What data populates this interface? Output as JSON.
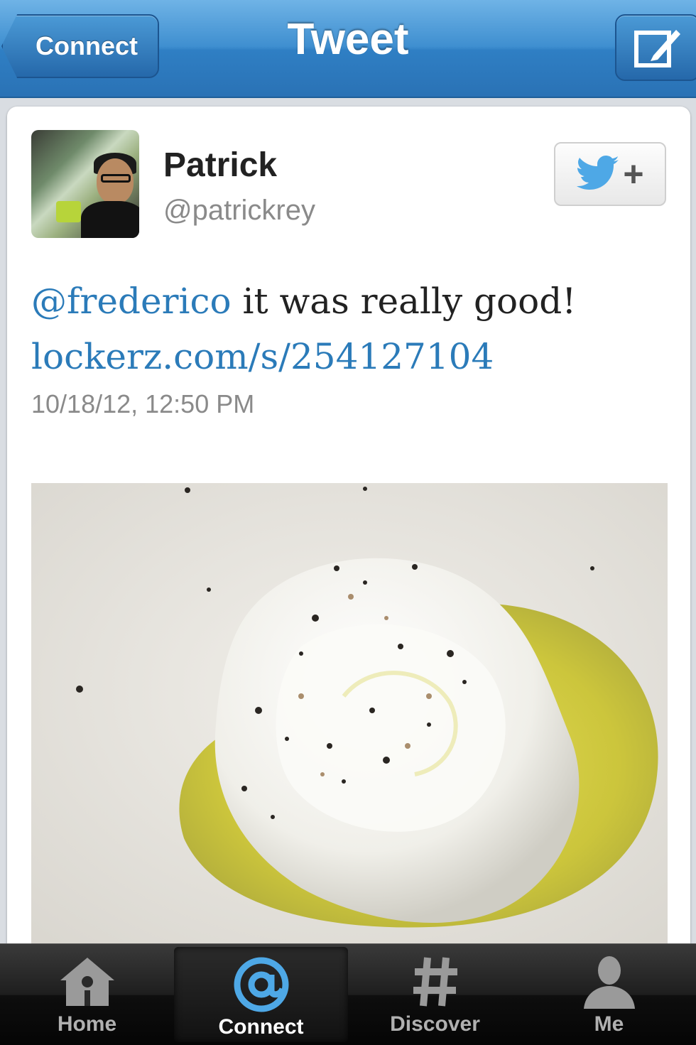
{
  "navbar": {
    "back_label": "Connect",
    "title": "Tweet",
    "compose_icon": "compose-icon"
  },
  "tweet": {
    "user": {
      "name": "Patrick",
      "handle": "@patrickrey"
    },
    "text_mention": "@frederico",
    "text_body": " it was really good!",
    "text_link": "lockerz.com/s/254127104",
    "timestamp": "10/18/12, 12:50 PM",
    "photo": "poached-egg-photo"
  },
  "follow_button": {
    "icon": "twitter-bird-icon",
    "plus": "+"
  },
  "tabbar": {
    "tabs": [
      {
        "label": "Home",
        "icon": "home-icon",
        "active": false
      },
      {
        "label": "Connect",
        "icon": "at-icon",
        "active": true
      },
      {
        "label": "Discover",
        "icon": "hash-icon",
        "active": false
      },
      {
        "label": "Me",
        "icon": "person-icon",
        "active": false
      }
    ]
  },
  "colors": {
    "nav_blue": "#3f8fd0",
    "link_blue": "#2b7bb9",
    "twitter_blue": "#4ea8e6"
  }
}
